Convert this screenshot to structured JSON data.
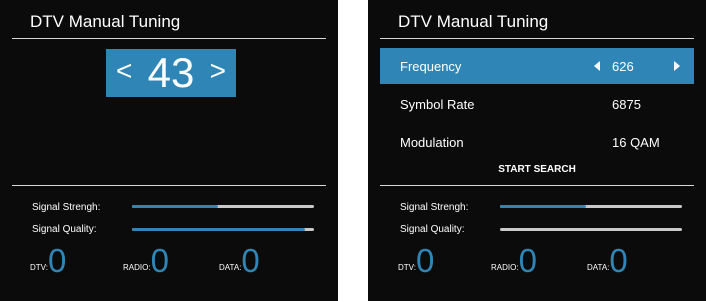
{
  "colors": {
    "accent": "#2f86b6",
    "background": "#0b0b0b",
    "track": "#c9c9c9",
    "text": "#ffffff"
  },
  "left_panel": {
    "title": "DTV Manual Tuning",
    "channel": {
      "left_arrow": "<",
      "value": "43",
      "right_arrow": ">"
    },
    "signal_strength": {
      "label": "Signal Strengh:",
      "level": 0.47
    },
    "signal_quality": {
      "label": "Signal Quality:",
      "level": 0.95
    },
    "counts": [
      {
        "label": "DTV:",
        "value": "0"
      },
      {
        "label": "RADIO:",
        "value": "0"
      },
      {
        "label": "DATA:",
        "value": "0"
      }
    ]
  },
  "right_panel": {
    "title": "DTV Manual Tuning",
    "menu": [
      {
        "label": "Frequency",
        "value": "626",
        "selected": true
      },
      {
        "label": "Symbol Rate",
        "value": "6875",
        "selected": false
      },
      {
        "label": "Modulation",
        "value": "16 QAM",
        "selected": false
      }
    ],
    "start_search": "START SEARCH",
    "signal_strength": {
      "label": "Signal Strengh:",
      "level": 0.47
    },
    "signal_quality": {
      "label": "Signal Quality:",
      "level": 0.0
    },
    "counts": [
      {
        "label": "DTV:",
        "value": "0"
      },
      {
        "label": "RADIO:",
        "value": "0"
      },
      {
        "label": "DATA:",
        "value": "0"
      }
    ]
  }
}
